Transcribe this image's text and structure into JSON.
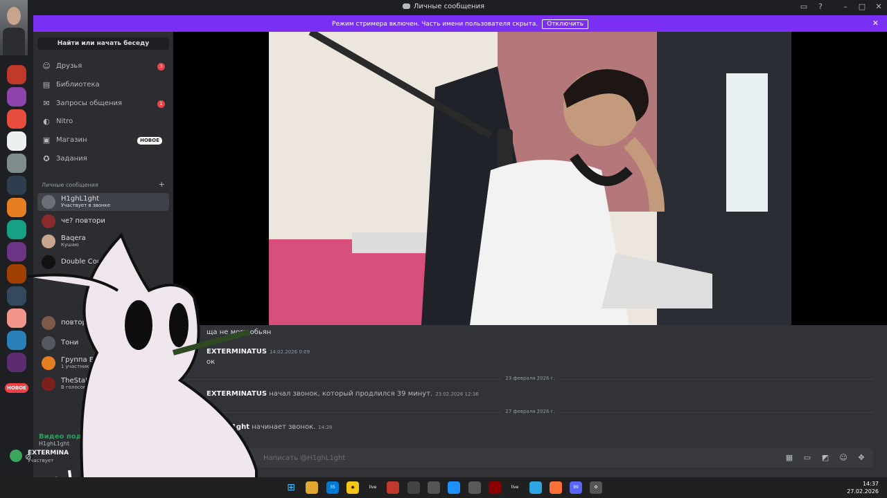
{
  "titlebar": {
    "title": "Личные сообщения"
  },
  "banner": {
    "message": "Режим стримера включен. Часть имени пользователя скрыта.",
    "button": "Отключить"
  },
  "sidebar": {
    "find_button": "Найти или начать беседу",
    "nav": [
      {
        "label": "Друзья",
        "icon": "friends-icon",
        "badge": "3"
      },
      {
        "label": "Библиотека",
        "icon": "library-icon"
      },
      {
        "label": "Запросы общения",
        "icon": "mail-icon",
        "badge": "1"
      },
      {
        "label": "Nitro",
        "icon": "nitro-icon"
      },
      {
        "label": "Магазин",
        "icon": "shop-icon",
        "tag": "НОВОЕ"
      },
      {
        "label": "Задания",
        "icon": "quests-icon"
      }
    ],
    "dm_header": "Личные сообщения",
    "dms": [
      {
        "name": "H1ghL1ght",
        "status": "Участвует в звонке",
        "active": true
      },
      {
        "name": "че? повтори"
      },
      {
        "name": "Baqera",
        "status": "Кушаю"
      },
      {
        "name": "Double Counter"
      },
      {
        "name": "повтори не слы"
      },
      {
        "name": "Тони"
      },
      {
        "name": "Группа EXTERM",
        "status": "1 участник"
      },
      {
        "name": "TheStaR",
        "status": "В голосовом"
      }
    ],
    "voice_status": "Видео подключен",
    "voice_channel": "H1ghL1ght",
    "user_name": "EXTERMINA",
    "user_status": "Участвует"
  },
  "servers": {
    "badge": "НОВОЕ"
  },
  "chat": {
    "messages": [
      {
        "text": "ща не могу обьян"
      },
      {
        "author": "EXTERMINATUS",
        "timestamp": "14.02.2026 0:09",
        "text": "ок"
      },
      {
        "author": "EXTERMINATUS",
        "action": "начал звонок, который продлился 39 минут.",
        "timestamp": "23.02.2026 12:36"
      },
      {
        "author": "H1ghL1ght",
        "action": "начинает звонок.",
        "timestamp": "14:28"
      }
    ],
    "dividers": [
      "23 февраля 2026 г.",
      "27 февраля 2026 г."
    ],
    "composer_placeholder": "Написать @H1ghL1ght"
  },
  "taskbar": {
    "time": "14:37",
    "date": "27.02.2026",
    "badge_mail": "35",
    "badge_discord": "99"
  }
}
